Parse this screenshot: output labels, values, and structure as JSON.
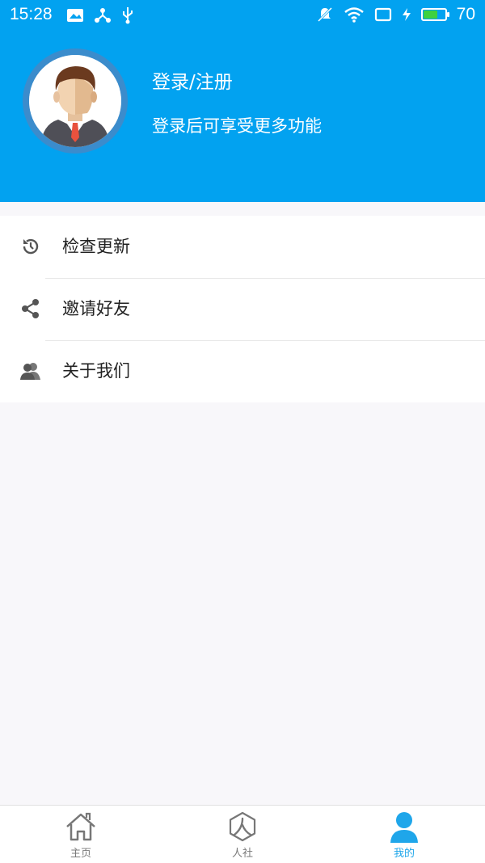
{
  "status": {
    "time": "15:28",
    "battery": "70",
    "battery_level": 0.7
  },
  "profile": {
    "title": "登录/注册",
    "subtitle": "登录后可享受更多功能"
  },
  "menu": [
    {
      "label": "检查更新",
      "icon": "refresh-clock-icon"
    },
    {
      "label": "邀请好友",
      "icon": "share-icon"
    },
    {
      "label": "关于我们",
      "icon": "users-icon"
    }
  ],
  "tabs": [
    {
      "label": "主页",
      "icon": "home-icon"
    },
    {
      "label": "人社",
      "icon": "ren-hexagon-icon"
    },
    {
      "label": "我的",
      "icon": "person-icon",
      "active": true
    }
  ],
  "colors": {
    "header": "#02a2f0",
    "accent": "#1fa6ea",
    "battery": "#3ed13f"
  }
}
